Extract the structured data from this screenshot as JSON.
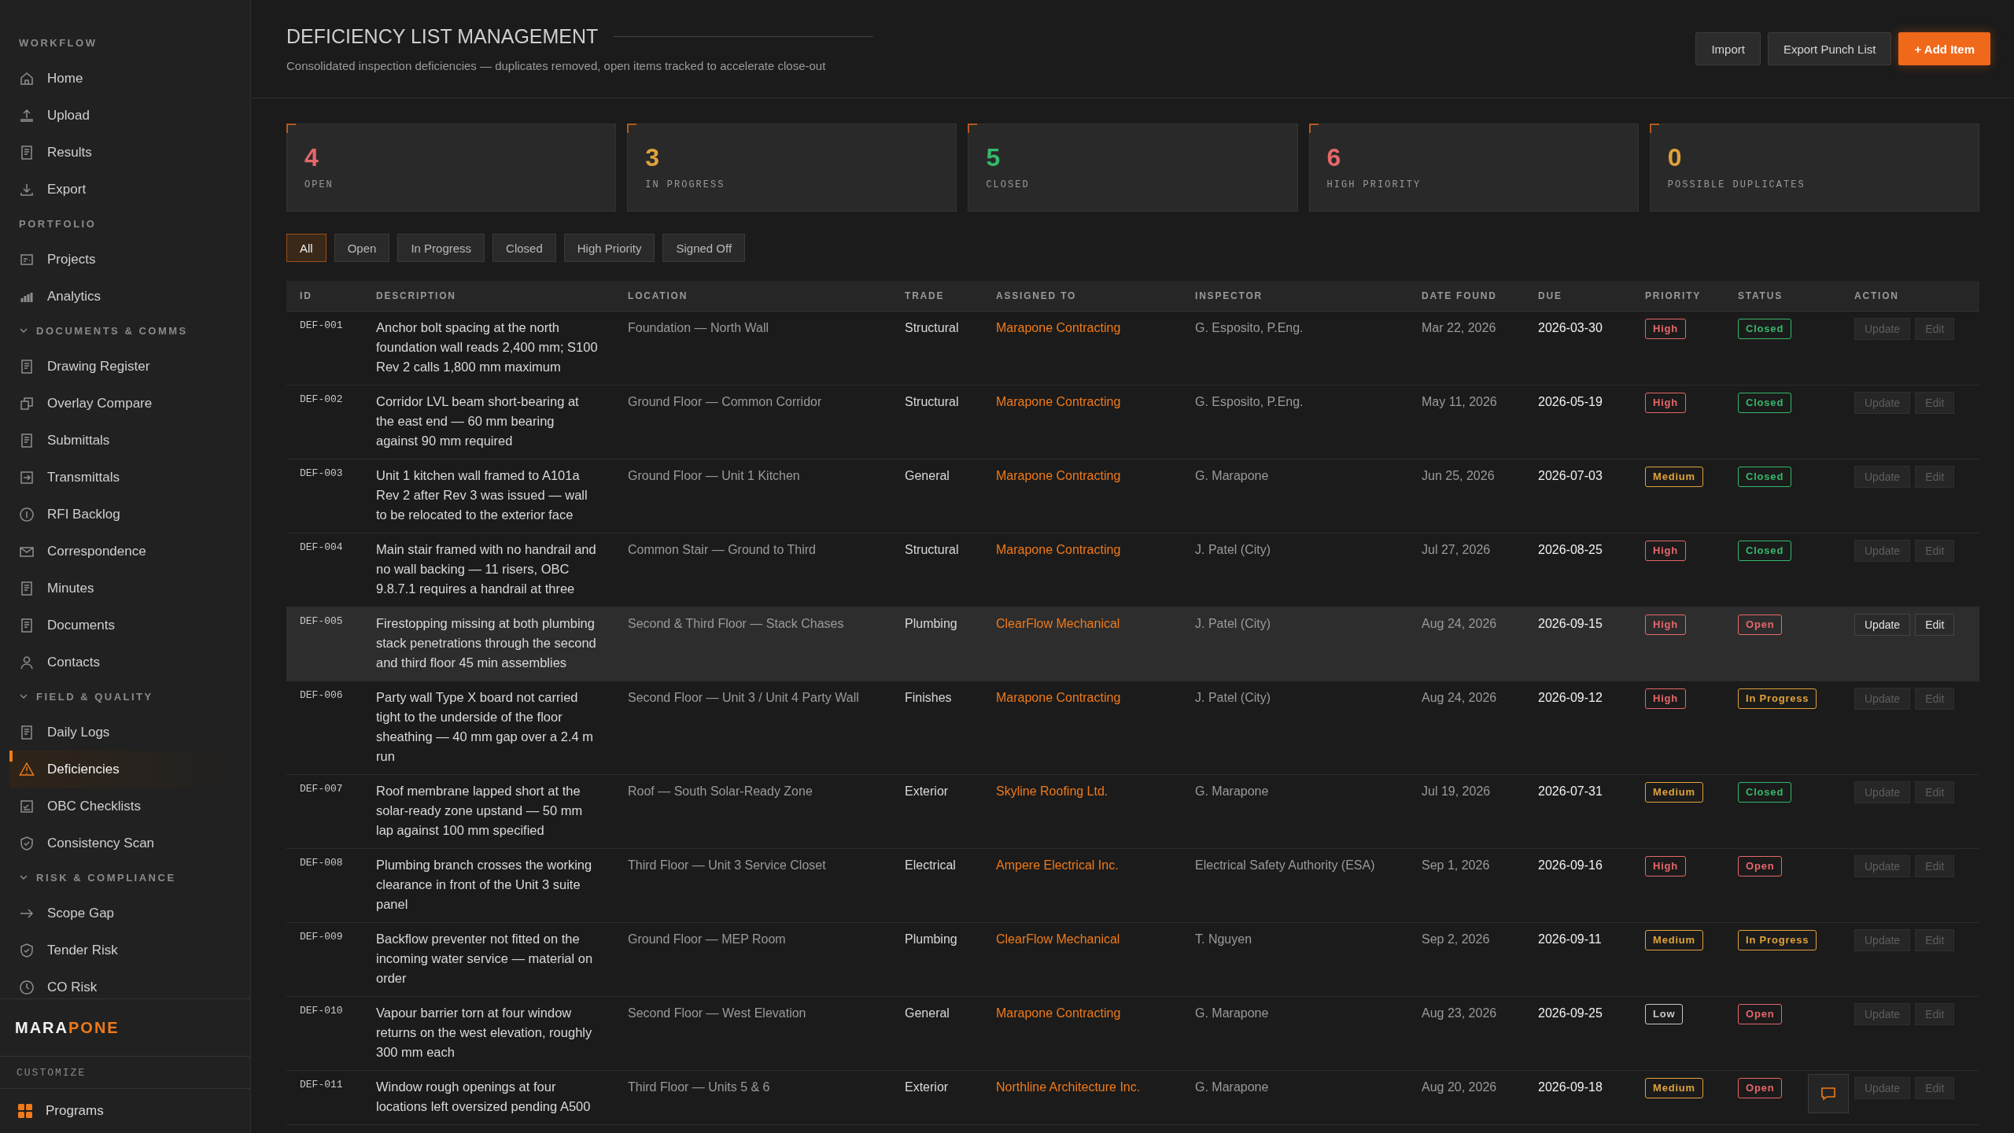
{
  "sidebar": {
    "sections": [
      {
        "title": "WORKFLOW",
        "kind": "static",
        "items": [
          {
            "label": "Home",
            "selected": false
          },
          {
            "label": "Upload",
            "selected": false
          },
          {
            "label": "Results",
            "selected": false
          },
          {
            "label": "Export",
            "selected": false
          }
        ]
      },
      {
        "title": "PORTFOLIO",
        "kind": "static",
        "items": [
          {
            "label": "Projects",
            "selected": false
          },
          {
            "label": "Analytics",
            "selected": false
          }
        ]
      },
      {
        "title": "DOCUMENTS & COMMS",
        "kind": "collapsible",
        "expanded": true,
        "items": [
          {
            "label": "Drawing Register",
            "selected": false
          },
          {
            "label": "Overlay Compare",
            "selected": false
          },
          {
            "label": "Submittals",
            "selected": false
          },
          {
            "label": "Transmittals",
            "selected": false
          },
          {
            "label": "RFI Backlog",
            "selected": false
          },
          {
            "label": "Correspondence",
            "selected": false
          },
          {
            "label": "Minutes",
            "selected": false
          },
          {
            "label": "Documents",
            "selected": false
          },
          {
            "label": "Contacts",
            "selected": false
          }
        ]
      },
      {
        "title": "FIELD & QUALITY",
        "kind": "collapsible",
        "expanded": true,
        "items": [
          {
            "label": "Daily Logs",
            "selected": false
          },
          {
            "label": "Deficiencies",
            "selected": true
          },
          {
            "label": "OBC Checklists",
            "selected": false
          },
          {
            "label": "Consistency Scan",
            "selected": false
          }
        ]
      },
      {
        "title": "RISK & COMPLIANCE",
        "kind": "collapsible",
        "expanded": true,
        "items": [
          {
            "label": "Scope Gap",
            "selected": false
          },
          {
            "label": "Tender Risk",
            "selected": false
          },
          {
            "label": "CO Risk",
            "selected": false
          }
        ]
      }
    ],
    "brand": [
      "MARA",
      "PONE"
    ],
    "customize": "CUSTOMIZE",
    "programs": "Programs"
  },
  "header": {
    "title": "DEFICIENCY LIST MANAGEMENT",
    "subtitle": "Consolidated inspection deficiencies — duplicates removed, open items tracked to accelerate close-out",
    "buttons": [
      {
        "label": "Import",
        "kind": "secondary"
      },
      {
        "label": "Export Punch List",
        "kind": "secondary"
      },
      {
        "label": "+ Add Item",
        "kind": "primary"
      }
    ]
  },
  "stats": [
    {
      "value": "4",
      "label": "OPEN",
      "color": "#e5676a"
    },
    {
      "value": "3",
      "label": "IN PROGRESS",
      "color": "#e0a23a"
    },
    {
      "value": "5",
      "label": "CLOSED",
      "color": "#35b86b"
    },
    {
      "value": "6",
      "label": "HIGH PRIORITY",
      "color": "#e5676a"
    },
    {
      "value": "0",
      "label": "POSSIBLE DUPLICATES",
      "color": "#e0a23a"
    }
  ],
  "filters": [
    {
      "label": "All",
      "selected": true
    },
    {
      "label": "Open",
      "selected": false
    },
    {
      "label": "In Progress",
      "selected": false
    },
    {
      "label": "Closed",
      "selected": false
    },
    {
      "label": "High Priority",
      "selected": false
    },
    {
      "label": "Signed Off",
      "selected": false
    }
  ],
  "table": {
    "columns": [
      "ID",
      "DESCRIPTION",
      "LOCATION",
      "TRADE",
      "ASSIGNED TO",
      "INSPECTOR",
      "DATE FOUND",
      "DUE",
      "PRIORITY",
      "STATUS",
      "ACTION"
    ],
    "rows": [
      {
        "id": "DEF-001",
        "actions": [
          "Update",
          "Edit"
        ],
        "description": "Anchor bolt spacing at the north foundation wall reads 2,400 mm; S100 Rev 2 calls 1,800 mm maximum",
        "location": "Foundation — North Wall",
        "trade": "Structural",
        "assigned": "Marapone Contracting",
        "inspector": "G. Esposito, P.Eng.",
        "found": "Mar 22, 2026",
        "due": "2026-03-30",
        "priority": {
          "text": "High",
          "color": "#e5676a"
        },
        "status": {
          "text": "Closed",
          "color": "#35b86b"
        },
        "selected": false
      },
      {
        "id": "DEF-002",
        "actions": [
          "Update",
          "Edit"
        ],
        "description": "Corridor LVL beam short-bearing at the east end — 60 mm bearing against 90 mm required",
        "location": "Ground Floor — Common Corridor",
        "trade": "Structural",
        "assigned": "Marapone Contracting",
        "inspector": "G. Esposito, P.Eng.",
        "found": "May 11, 2026",
        "due": "2026-05-19",
        "priority": {
          "text": "High",
          "color": "#e5676a"
        },
        "status": {
          "text": "Closed",
          "color": "#35b86b"
        },
        "selected": false
      },
      {
        "id": "DEF-003",
        "actions": [
          "Update",
          "Edit"
        ],
        "description": "Unit 1 kitchen wall framed to A101a Rev 2 after Rev 3 was issued — wall to be relocated to the exterior face",
        "location": "Ground Floor — Unit 1 Kitchen",
        "trade": "General",
        "assigned": "Marapone Contracting",
        "inspector": "G. Marapone",
        "found": "Jun 25, 2026",
        "due": "2026-07-03",
        "priority": {
          "text": "Medium",
          "color": "#e0a23a"
        },
        "status": {
          "text": "Closed",
          "color": "#35b86b"
        },
        "selected": false
      },
      {
        "id": "DEF-004",
        "actions": [
          "Update",
          "Edit"
        ],
        "description": "Main stair framed with no handrail and no wall backing — 11 risers, OBC 9.8.7.1 requires a handrail at three",
        "location": "Common Stair — Ground to Third",
        "trade": "Structural",
        "assigned": "Marapone Contracting",
        "inspector": "J. Patel (City)",
        "found": "Jul 27, 2026",
        "due": "2026-08-25",
        "priority": {
          "text": "High",
          "color": "#e5676a"
        },
        "status": {
          "text": "Closed",
          "color": "#35b86b"
        },
        "selected": false
      },
      {
        "id": "DEF-005",
        "actions": [
          "Update",
          "Edit"
        ],
        "description": "Firestopping missing at both plumbing stack penetrations through the second and third floor 45 min assemblies",
        "location": "Second & Third Floor — Stack Chases",
        "trade": "Plumbing",
        "assigned": "ClearFlow Mechanical",
        "inspector": "J. Patel (City)",
        "found": "Aug 24, 2026",
        "due": "2026-09-15",
        "priority": {
          "text": "High",
          "color": "#e5676a"
        },
        "status": {
          "text": "Open",
          "color": "#e5676a"
        },
        "selected": true
      },
      {
        "id": "DEF-006",
        "actions": [
          "Update",
          "Edit"
        ],
        "description": "Party wall Type X board not carried tight to the underside of the floor sheathing — 40 mm gap over a 2.4 m run",
        "location": "Second Floor — Unit 3 / Unit 4 Party Wall",
        "trade": "Finishes",
        "assigned": "Marapone Contracting",
        "inspector": "J. Patel (City)",
        "found": "Aug 24, 2026",
        "due": "2026-09-12",
        "priority": {
          "text": "High",
          "color": "#e5676a"
        },
        "status": {
          "text": "In Progress",
          "color": "#e0a23a"
        },
        "selected": false
      },
      {
        "id": "DEF-007",
        "actions": [
          "Update",
          "Edit"
        ],
        "description": "Roof membrane lapped short at the solar-ready zone upstand — 50 mm lap against 100 mm specified",
        "location": "Roof — South Solar-Ready Zone",
        "trade": "Exterior",
        "assigned": "Skyline Roofing Ltd.",
        "inspector": "G. Marapone",
        "found": "Jul 19, 2026",
        "due": "2026-07-31",
        "priority": {
          "text": "Medium",
          "color": "#e0a23a"
        },
        "status": {
          "text": "Closed",
          "color": "#35b86b"
        },
        "selected": false
      },
      {
        "id": "DEF-008",
        "actions": [
          "Update",
          "Edit"
        ],
        "description": "Plumbing branch crosses the working clearance in front of the Unit 3 suite panel",
        "location": "Third Floor — Unit 3 Service Closet",
        "trade": "Electrical",
        "assigned": "Ampere Electrical Inc.",
        "inspector": "Electrical Safety Authority (ESA)",
        "found": "Sep 1, 2026",
        "due": "2026-09-16",
        "priority": {
          "text": "High",
          "color": "#e5676a"
        },
        "status": {
          "text": "Open",
          "color": "#e5676a"
        },
        "selected": false
      },
      {
        "id": "DEF-009",
        "actions": [
          "Update",
          "Edit"
        ],
        "description": "Backflow preventer not fitted on the incoming water service — material on order",
        "location": "Ground Floor — MEP Room",
        "trade": "Plumbing",
        "assigned": "ClearFlow Mechanical",
        "inspector": "T. Nguyen",
        "found": "Sep 2, 2026",
        "due": "2026-09-11",
        "priority": {
          "text": "Medium",
          "color": "#e0a23a"
        },
        "status": {
          "text": "In Progress",
          "color": "#e0a23a"
        },
        "selected": false
      },
      {
        "id": "DEF-010",
        "actions": [
          "Update",
          "Edit"
        ],
        "description": "Vapour barrier torn at four window returns on the west elevation, roughly 300 mm each",
        "location": "Second Floor — West Elevation",
        "trade": "General",
        "assigned": "Marapone Contracting",
        "inspector": "G. Marapone",
        "found": "Aug 23, 2026",
        "due": "2026-09-25",
        "priority": {
          "text": "Low",
          "color": "#c8c8c8"
        },
        "status": {
          "text": "Open",
          "color": "#e5676a"
        },
        "selected": false
      },
      {
        "id": "DEF-011",
        "actions": [
          "Update",
          "Edit"
        ],
        "description": "Window rough openings at four locations left oversized pending A500",
        "location": "Third Floor — Units 5 & 6",
        "trade": "Exterior",
        "assigned": "Northline Architecture Inc.",
        "inspector": "G. Marapone",
        "found": "Aug 20, 2026",
        "due": "2026-09-18",
        "priority": {
          "text": "Medium",
          "color": "#e0a23a"
        },
        "status": {
          "text": "Open",
          "color": "#e5676a"
        },
        "selected": false
      }
    ]
  }
}
